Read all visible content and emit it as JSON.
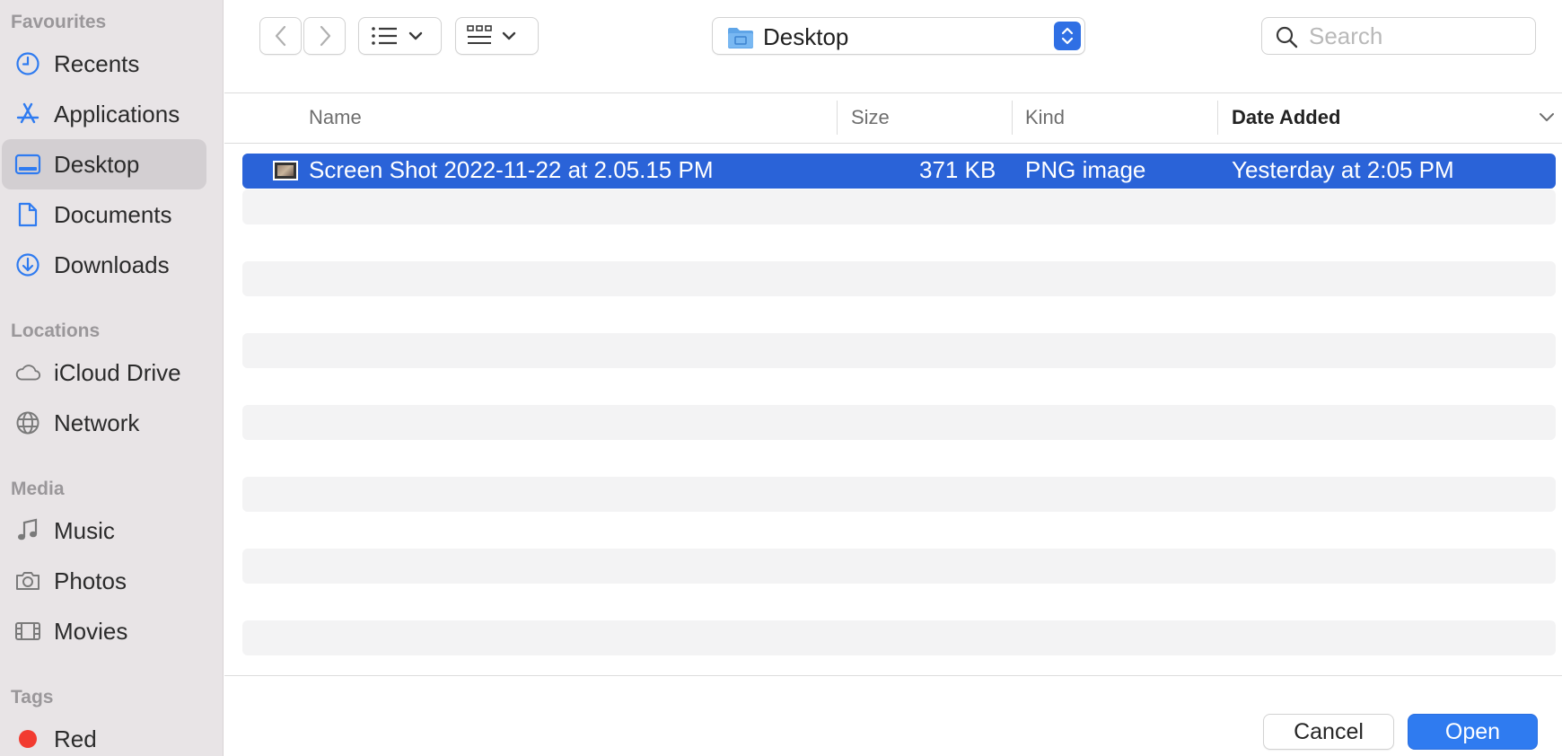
{
  "sidebar": {
    "sections": [
      {
        "title": "Favourites"
      },
      {
        "title": "Locations"
      },
      {
        "title": "Media"
      },
      {
        "title": "Tags"
      }
    ],
    "favourites": [
      {
        "label": "Recents",
        "icon": "clock-icon"
      },
      {
        "label": "Applications",
        "icon": "applications-icon"
      },
      {
        "label": "Desktop",
        "icon": "desktop-icon",
        "selected": true
      },
      {
        "label": "Documents",
        "icon": "document-icon"
      },
      {
        "label": "Downloads",
        "icon": "download-icon"
      }
    ],
    "locations": [
      {
        "label": "iCloud Drive",
        "icon": "cloud-icon"
      },
      {
        "label": "Network",
        "icon": "globe-icon"
      }
    ],
    "media": [
      {
        "label": "Music",
        "icon": "music-note-icon"
      },
      {
        "label": "Photos",
        "icon": "camera-icon"
      },
      {
        "label": "Movies",
        "icon": "film-icon"
      }
    ],
    "tags": [
      {
        "label": "Red",
        "color": "#f23b30"
      }
    ]
  },
  "toolbar": {
    "location_label": "Desktop",
    "search_placeholder": "Search"
  },
  "columns": {
    "name": "Name",
    "size": "Size",
    "kind": "Kind",
    "date_added": "Date Added"
  },
  "files": [
    {
      "name": "Screen Shot 2022-11-22 at 2.05.15 PM",
      "size": "371 KB",
      "kind": "PNG image",
      "date_added": "Yesterday at 2:05 PM",
      "selected": true
    }
  ],
  "buttons": {
    "cancel": "Cancel",
    "open": "Open"
  },
  "colors": {
    "accent": "#2a63d8",
    "sidebar_icon": "#2f7bf0",
    "tag_red": "#f23b30"
  }
}
